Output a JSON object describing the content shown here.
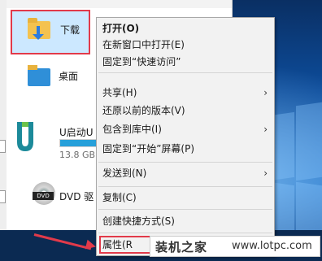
{
  "explorer": {
    "items": [
      {
        "label": "下载",
        "icon": "downloads-folder-icon"
      },
      {
        "label": "桌面",
        "icon": "desktop-folder-icon"
      },
      {
        "label": "U启动U",
        "sub": "13.8 GB",
        "icon": "usb-drive-icon",
        "usage": 1.0
      },
      {
        "label": "DVD 驱",
        "icon": "dvd-drive-icon",
        "badge": "DVD"
      }
    ]
  },
  "menu": {
    "items": [
      {
        "label": "打开(O)",
        "bold": true
      },
      {
        "label": "在新窗口中打开(E)"
      },
      {
        "label": "固定到“快速访问”"
      },
      {
        "label": "共享(H)",
        "submenu": true
      },
      {
        "label": "还原以前的版本(V)"
      },
      {
        "label": "包含到库中(I)",
        "submenu": true
      },
      {
        "label": "固定到“开始”屏幕(P)"
      },
      {
        "label": "发送到(N)",
        "submenu": true
      },
      {
        "label": "复制(C)"
      },
      {
        "label": "创建快捷方式(S)"
      },
      {
        "label": "属性(R"
      }
    ],
    "chevron": "›"
  },
  "watermark": {
    "cn": "装机之家",
    "url": "www.lotpc.com"
  },
  "colors": {
    "highlight": "#e23a4a",
    "selection": "#cce8ff",
    "menu_bg": "#f2f2f2"
  }
}
